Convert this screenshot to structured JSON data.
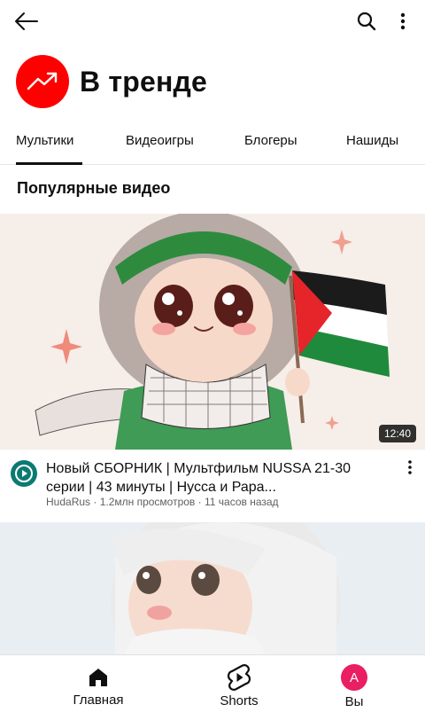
{
  "header": {
    "title": "В тренде"
  },
  "tabs": [
    {
      "label": "Мультики",
      "active": true
    },
    {
      "label": "Видеоигры",
      "active": false
    },
    {
      "label": "Блогеры",
      "active": false
    },
    {
      "label": "Нашиды",
      "active": false
    }
  ],
  "section": {
    "title": "Популярные видео"
  },
  "videos": [
    {
      "duration": "12:40",
      "title": "Новый СБОРНИК | Мультфильм NUSSA 21-30 серии | 43 минуты | Нусса и Рара...",
      "channel": "HudaRus",
      "views": "1.2млн просмотров",
      "age": "11 часов назад",
      "sub": "HudaRus · 1.2млн просмотров · 11 часов назад"
    },
    {
      "duration": "",
      "title": "",
      "channel": "",
      "sub": ""
    }
  ],
  "bottom_nav": {
    "home": "Главная",
    "shorts": "Shorts",
    "you": "Вы",
    "avatar_letter": "A"
  },
  "colors": {
    "brand_red": "#ff0000",
    "avatar_pink": "#e91e63",
    "channel_teal": "#0d7a72"
  },
  "icons": [
    "back-arrow-icon",
    "search-icon",
    "more-vert-icon",
    "trending-icon",
    "home-icon",
    "shorts-icon"
  ]
}
